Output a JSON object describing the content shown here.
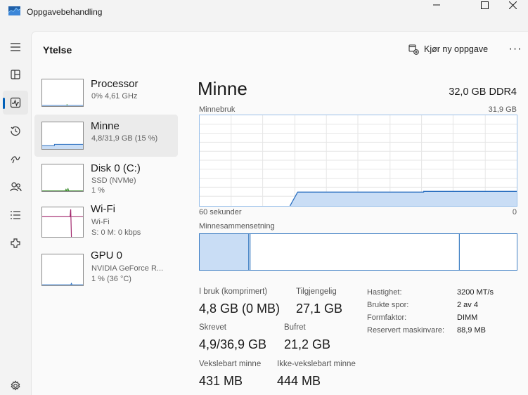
{
  "window": {
    "title": "Oppgavebehandling"
  },
  "header": {
    "title": "Ytelse",
    "run_task_label": "Kjør ny oppgave",
    "more_label": "···"
  },
  "nav": {
    "items": [
      {
        "icon": "hamburger-menu-icon"
      },
      {
        "icon": "processes-icon"
      },
      {
        "icon": "performance-icon",
        "active": true
      },
      {
        "icon": "app-history-icon"
      },
      {
        "icon": "startup-apps-icon"
      },
      {
        "icon": "users-icon"
      },
      {
        "icon": "details-icon"
      },
      {
        "icon": "services-icon"
      },
      {
        "icon": "settings-icon"
      }
    ]
  },
  "devices": [
    {
      "name": "Processor",
      "sub1": "0% 4,61 GHz",
      "sub2": ""
    },
    {
      "name": "Minne",
      "sub1": "4,8/31,9 GB (15 %)",
      "sub2": "",
      "selected": true
    },
    {
      "name": "Disk 0 (C:)",
      "sub1": "SSD (NVMe)",
      "sub2": "1 %"
    },
    {
      "name": "Wi-Fi",
      "sub1": "Wi-Fi",
      "sub2": "S: 0 M: 0 kbps"
    },
    {
      "name": "GPU 0",
      "sub1": "NVIDIA GeForce R...",
      "sub2": "1 % (36 °C)"
    }
  ],
  "main": {
    "title": "Minne",
    "spec": "32,0 GB DDR4",
    "usage_label": "Minnebruk",
    "usage_max": "31,9 GB",
    "time_left": "60 sekunder",
    "time_right": "0",
    "composition_label": "Minnesammensetning",
    "usage_fraction": 0.15
  },
  "stats": {
    "in_use_label": "I bruk (komprimert)",
    "in_use_value": "4,8 GB (0 MB)",
    "available_label": "Tilgjengelig",
    "available_value": "27,1 GB",
    "committed_label": "Skrevet",
    "committed_value": "4,9/36,9 GB",
    "cached_label": "Bufret",
    "cached_value": "21,2 GB",
    "paged_label": "Vekslebart minne",
    "paged_value": "431 MB",
    "nonpaged_label": "Ikke-vekslebart minne",
    "nonpaged_value": "444 MB"
  },
  "details": {
    "speed_label": "Hastighet:",
    "speed_value": "3200 MT/s",
    "slots_label": "Brukte spor:",
    "slots_value": "2 av 4",
    "form_label": "Formfaktor:",
    "form_value": "DIMM",
    "reserved_label": "Reservert maskinvare:",
    "reserved_value": "88,9 MB"
  },
  "colors": {
    "accent": "#005fb8",
    "memory_line": "#2a6fc0",
    "memory_fill": "#c9ddf5",
    "wifi_line": "#a0246a",
    "disk_green": "#3e8f2f"
  }
}
